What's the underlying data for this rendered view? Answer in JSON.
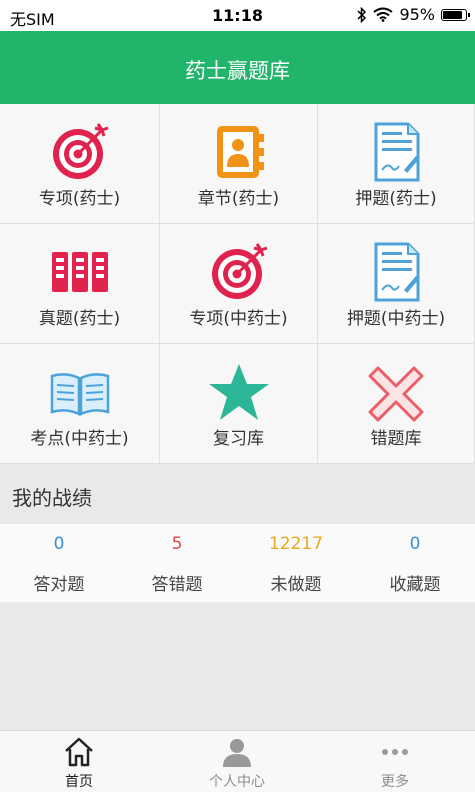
{
  "status_bar": {
    "carrier": "无SIM",
    "time": "11:18",
    "battery_text": "95%",
    "battery_level": 0.95,
    "icons": [
      "bluetooth-icon",
      "wifi-icon",
      "battery-icon"
    ]
  },
  "nav": {
    "title": "药士赢题库"
  },
  "grid": {
    "items": [
      {
        "label": "专项(药士)",
        "icon": "target-icon"
      },
      {
        "label": "章节(药士)",
        "icon": "contact-book-icon"
      },
      {
        "label": "押题(药士)",
        "icon": "document-icon"
      },
      {
        "label": "真题(药士)",
        "icon": "binders-icon"
      },
      {
        "label": "专项(中药士)",
        "icon": "target-icon"
      },
      {
        "label": "押题(中药士)",
        "icon": "document-icon"
      },
      {
        "label": "考点(中药士)",
        "icon": "open-book-icon"
      },
      {
        "label": "复习库",
        "icon": "star-icon"
      },
      {
        "label": "错题库",
        "icon": "cross-icon"
      }
    ]
  },
  "stats": {
    "title": "我的战绩",
    "items": [
      {
        "value": "0",
        "label": "答对题",
        "color": "#3a8fd0"
      },
      {
        "value": "5",
        "label": "答错题",
        "color": "#e04646"
      },
      {
        "value": "12217",
        "label": "未做题",
        "color": "#e8a91e"
      },
      {
        "value": "0",
        "label": "收藏题",
        "color": "#3a8fd0"
      }
    ]
  },
  "tabbar": {
    "items": [
      {
        "label": "首页",
        "icon": "home-icon",
        "active": true
      },
      {
        "label": "个人中心",
        "icon": "person-icon",
        "active": false
      },
      {
        "label": "更多",
        "icon": "more-icon",
        "active": false
      }
    ]
  },
  "colors": {
    "brand": "#20b56a",
    "target": "#e0234e",
    "orange": "#f09316",
    "blue": "#4ba3d9",
    "teal": "#2cb597",
    "active_tab": "#222222",
    "inactive_tab": "#8e8e8e"
  }
}
